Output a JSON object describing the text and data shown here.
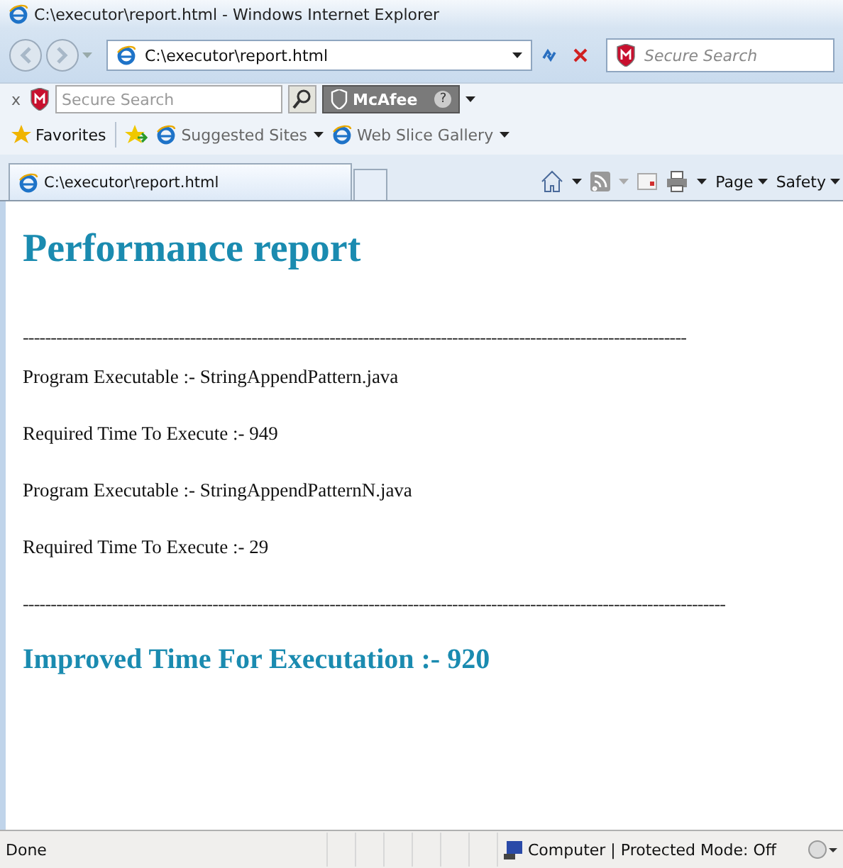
{
  "window": {
    "title": "C:\\executor\\report.html - Windows Internet Explorer"
  },
  "address_bar": {
    "value": "C:\\executor\\report.html"
  },
  "search_box": {
    "placeholder": "Secure Search"
  },
  "mcafee_toolbar": {
    "close": "x",
    "search_placeholder": "Secure Search",
    "brand": "McAfee",
    "help": "?"
  },
  "favorites_bar": {
    "favorites": "Favorites",
    "items": [
      {
        "label": "Suggested Sites"
      },
      {
        "label": "Web Slice Gallery"
      }
    ]
  },
  "tabs": [
    {
      "label": "C:\\executor\\report.html",
      "selected": true
    },
    {
      "selected": false
    }
  ],
  "command_bar": {
    "items": [
      {
        "kind": "home"
      },
      {
        "kind": "feed"
      },
      {
        "kind": "mail"
      },
      {
        "kind": "print"
      },
      {
        "kind": "text",
        "label": "Page"
      },
      {
        "kind": "text",
        "label": "Safety"
      }
    ]
  },
  "page": {
    "heading": "Performance report",
    "blocks": [
      {
        "kind": "rule",
        "text": "-----------------------------------------------------------------------------------------------------------------------"
      },
      {
        "kind": "line",
        "text": "Program Executable :- StringAppendPattern.java"
      },
      {
        "kind": "line",
        "text": "Required Time To Execute :- 949"
      },
      {
        "kind": "line",
        "text": "Program Executable :- StringAppendPatternN.java"
      },
      {
        "kind": "line",
        "text": "Required Time To Execute :- 29"
      },
      {
        "kind": "rule",
        "text": "------------------------------------------------------------------------------------------------------------------------------"
      },
      {
        "kind": "result",
        "text": "Improved Time For Executation :- 920"
      }
    ]
  },
  "status_bar": {
    "status": "Done",
    "zone": "Computer | Protected Mode: Off"
  }
}
